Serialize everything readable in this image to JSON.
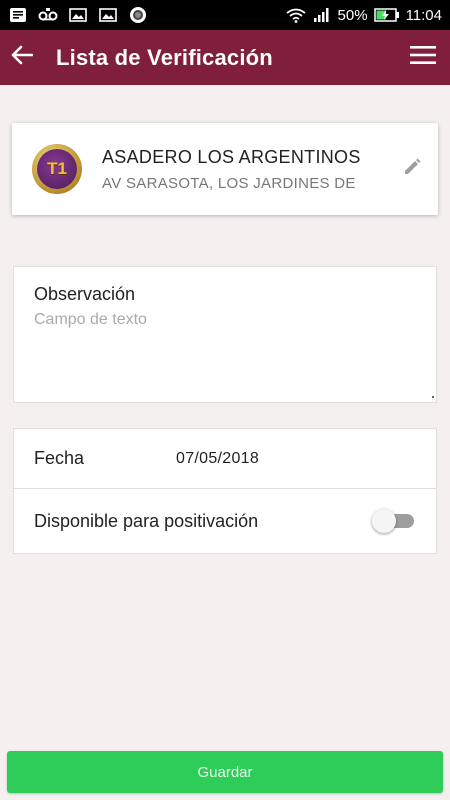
{
  "status_bar": {
    "battery": "50%",
    "time": "11:04",
    "icons": [
      "message-icon",
      "voicemail-icon",
      "image-icon",
      "image-icon",
      "record-icon",
      "wifi-icon",
      "signal-icon",
      "battery-charging-icon"
    ]
  },
  "app_bar": {
    "title": "Lista de Verificación",
    "color": "#7f1f3a"
  },
  "store": {
    "badge": "T1",
    "name": "ASADERO LOS ARGENTINOS",
    "address": "AV SARASOTA, LOS JARDINES DE"
  },
  "observation": {
    "label": "Observación",
    "placeholder": "Campo de texto",
    "value": ""
  },
  "date": {
    "label": "Fecha",
    "value": "07/05/2018"
  },
  "availability": {
    "label": "Disponible para positivación",
    "enabled": false
  },
  "save": {
    "label": "Guardar",
    "color": "#2ecc58"
  }
}
